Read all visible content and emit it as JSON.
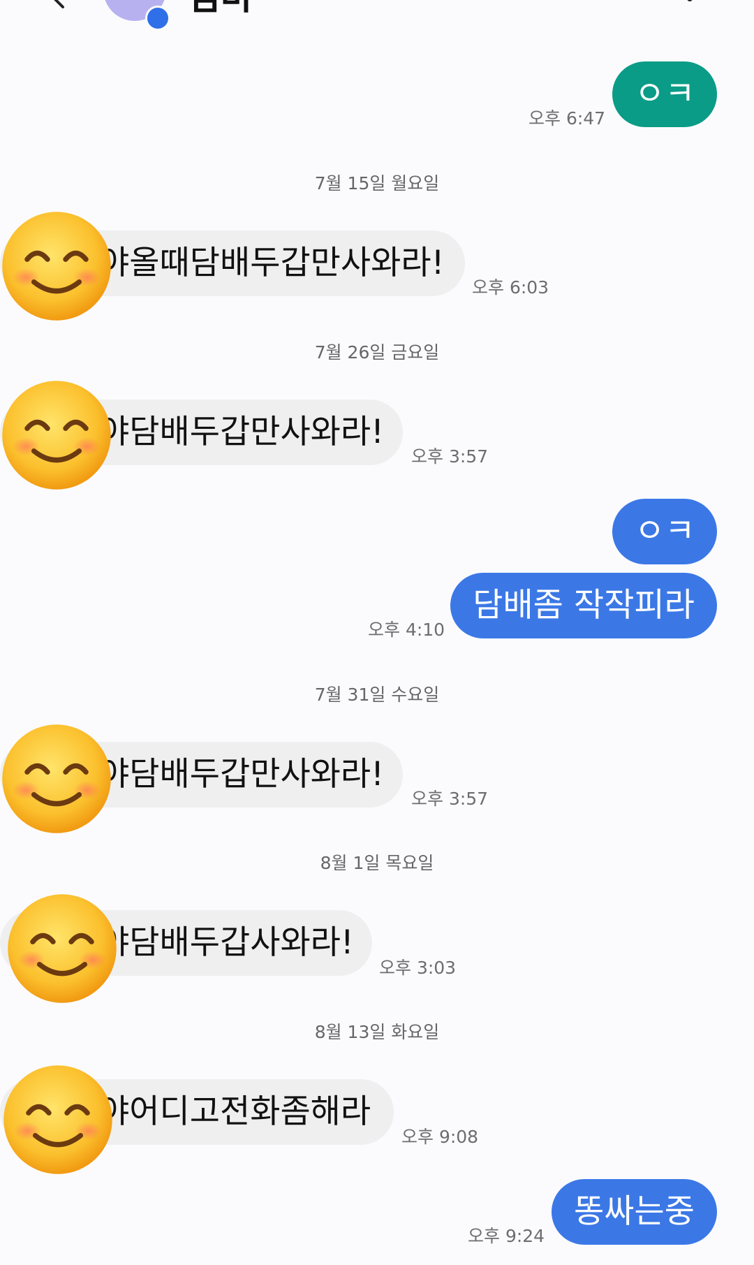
{
  "header": {
    "contact_name": "엄마",
    "icons": [
      "back-arrow-icon",
      "avatar",
      "edit-icon",
      "more-vert-icon"
    ]
  },
  "colors": {
    "outgoing_teal": "#0a9c86",
    "outgoing_blue": "#3b78e6",
    "incoming_bg": "#efefef",
    "background": "#fbfbfe"
  },
  "conversation": [
    {
      "type": "out",
      "text": "ㅇㅋ",
      "time": "오후 6:47"
    },
    {
      "type": "date",
      "text": "7월 15일 월요일"
    },
    {
      "type": "in",
      "text": "야올때담배두갑만사와라!",
      "time": "오후 6:03"
    },
    {
      "type": "date",
      "text": "7월 26일 금요일"
    },
    {
      "type": "in",
      "text": "야담배두갑만사와라!",
      "time": "오후 3:57"
    },
    {
      "type": "out",
      "text": "ㅇㅋ"
    },
    {
      "type": "out",
      "text": "담배좀 작작피라",
      "time": "오후 4:10"
    },
    {
      "type": "date",
      "text": "7월 31일 수요일"
    },
    {
      "type": "in",
      "text": "야담배두갑만사와라!",
      "time": "오후 3:57"
    },
    {
      "type": "date",
      "text": "8월 1일 목요일"
    },
    {
      "type": "in",
      "text": "야담배두갑사와라!",
      "time": "오후 3:03"
    },
    {
      "type": "date",
      "text": "8월 13일 화요일"
    },
    {
      "type": "in",
      "text": "야어디고전화좀해라",
      "time": "오후 9:08"
    },
    {
      "type": "out",
      "text": "똥싸는중",
      "time": "오후 9:24"
    }
  ]
}
